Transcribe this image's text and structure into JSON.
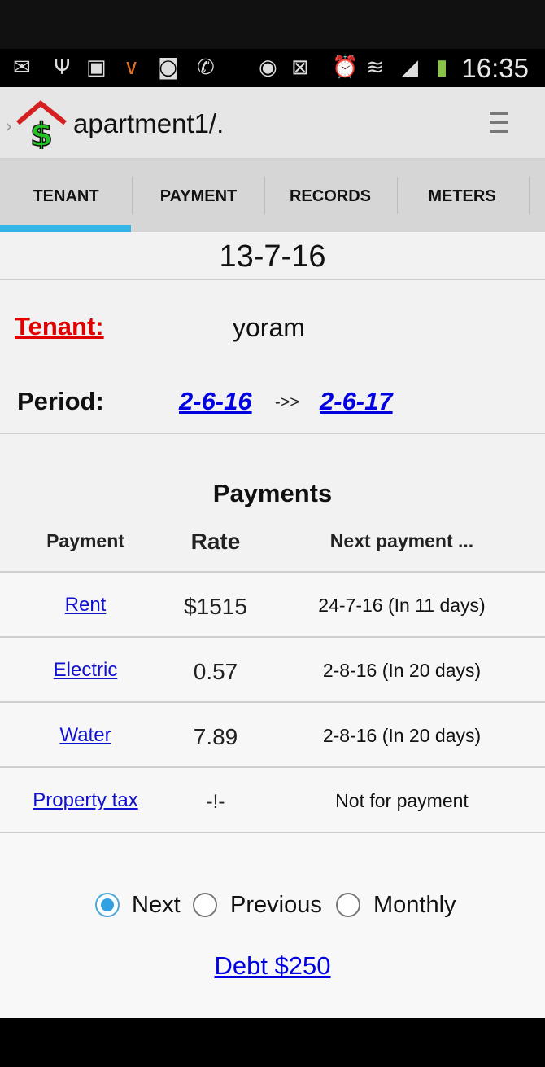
{
  "status_bar": {
    "time": "16:35",
    "icons": [
      "mail-icon",
      "usb-icon",
      "image-icon",
      "check-icon",
      "voicemail-icon",
      "phone-icon",
      "eye-icon",
      "nfc-icon",
      "alarm-icon",
      "wifi-icon",
      "signal-icon",
      "battery-icon"
    ]
  },
  "action_bar": {
    "title": "apartment1/.",
    "app_icon": "house-dollar-icon",
    "menu_icon": "overflow-menu-icon"
  },
  "tabs": [
    {
      "label": "TENANT",
      "selected": true
    },
    {
      "label": "PAYMENT",
      "selected": false
    },
    {
      "label": "RECORDS",
      "selected": false
    },
    {
      "label": "METERS",
      "selected": false
    }
  ],
  "accent_color": "#33b5e5",
  "date": "13-7-16",
  "tenant": {
    "label": "Tenant:",
    "name": "yoram"
  },
  "period": {
    "label": "Period:",
    "start": "2-6-16",
    "arrow": "->>",
    "end": "2-6-17"
  },
  "payments": {
    "title": "Payments",
    "headers": {
      "payment": "Payment",
      "rate": "Rate",
      "next": "Next payment ..."
    },
    "rows": [
      {
        "name": "Rent",
        "rate": "$1515",
        "next": "24-7-16 (In 11 days)"
      },
      {
        "name": "Electric",
        "rate": "0.57",
        "next": "2-8-16 (In 20 days)"
      },
      {
        "name": "Water",
        "rate": "7.89",
        "next": "2-8-16 (In 20 days)"
      },
      {
        "name": "Property tax",
        "rate": "-!-",
        "next": "Not for payment"
      }
    ]
  },
  "view_mode": {
    "options": [
      "Next",
      "Previous",
      "Monthly"
    ],
    "selected": "Next"
  },
  "debt": "Debt $250"
}
